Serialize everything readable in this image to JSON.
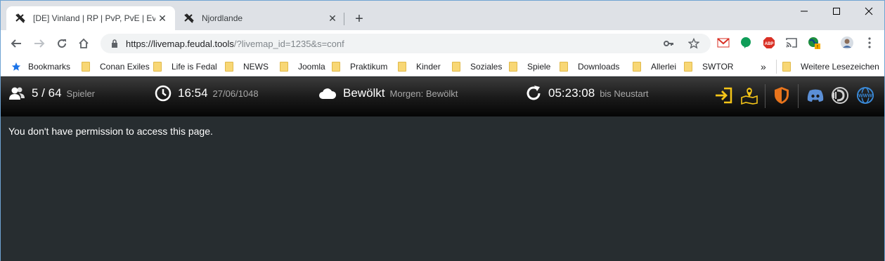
{
  "browser": {
    "tabs": [
      {
        "title": "[DE] Vinland | RP | PvP, PvE | Events",
        "active": true
      },
      {
        "title": "Njordlande",
        "active": false
      }
    ],
    "url_host": "https://livemap.feudal.tools",
    "url_path": "/?livemap_id=1235&s=conf",
    "bookmarks": [
      "Bookmarks",
      "Conan Exiles",
      "Life is Fedal",
      "NEWS",
      "Joomla",
      "Praktikum",
      "Kinder",
      "Soziales",
      "Spiele",
      "Downloads",
      "Allerlei",
      "SWTOR"
    ],
    "overflow_label": "»",
    "other_bookmarks": "Weitere Lesezeichen"
  },
  "header": {
    "players": {
      "value": "5 / 64",
      "label": "Spieler"
    },
    "time": {
      "value": "16:54",
      "date": "27/06/1048"
    },
    "weather": {
      "value": "Bewölkt",
      "forecast": "Morgen: Bewölkt"
    },
    "restart": {
      "value": "05:23:08",
      "label": "bis Neustart"
    }
  },
  "content": {
    "message": "You don't have permission to access this page."
  },
  "colors": {
    "accent_yellow": "#f5c518",
    "shield_orange": "#e8741c",
    "discord_blue": "#5b8fd6",
    "www_blue": "#3a8ad9"
  }
}
